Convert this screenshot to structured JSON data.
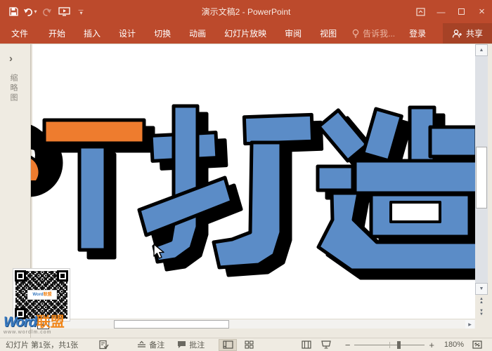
{
  "window": {
    "title": "演示文稿2 - PowerPoint"
  },
  "tabs": [
    "文件",
    "开始",
    "插入",
    "设计",
    "切换",
    "动画",
    "幻灯片放映",
    "审阅",
    "视图"
  ],
  "ribbon_right": {
    "tell_me": "告诉我...",
    "sign_in": "登录",
    "share": "共享"
  },
  "thumbnail_panel": {
    "expand_chevron": "›",
    "vertical_label": "缩略图"
  },
  "slide": {
    "visible_artwork_text": "T打造",
    "artwork_colors": {
      "blue": "#5B8CC7",
      "orange": "#EE7C2E",
      "outline": "#000000",
      "hole_white": "#FFFFFF"
    }
  },
  "watermark": {
    "brand_word": "Word",
    "brand_lm": "联盟",
    "url": "www.wordlm.com",
    "badge": "1",
    "qr_word": "Word",
    "qr_lm": "联盟"
  },
  "status_bar": {
    "slide_counter": "幻灯片 第1张，共1张",
    "notes": "备注",
    "comments": "批注",
    "zoom_percent": "180%"
  },
  "icons": {
    "caret_down": "▾",
    "minimize": "—",
    "close": "×",
    "scroll_up": "▲",
    "scroll_down": "▼",
    "scroll_left": "◀",
    "scroll_right": "▶",
    "dbl_up": "▲▲",
    "zoom_out": "−",
    "zoom_in": "+"
  },
  "colors": {
    "titlebar": "#BC4A2C",
    "share_button_bg": "#A64226",
    "workspace": "#EDE9E0",
    "slide_blue": "#5B8CC7",
    "slide_orange": "#EE7C2E"
  }
}
